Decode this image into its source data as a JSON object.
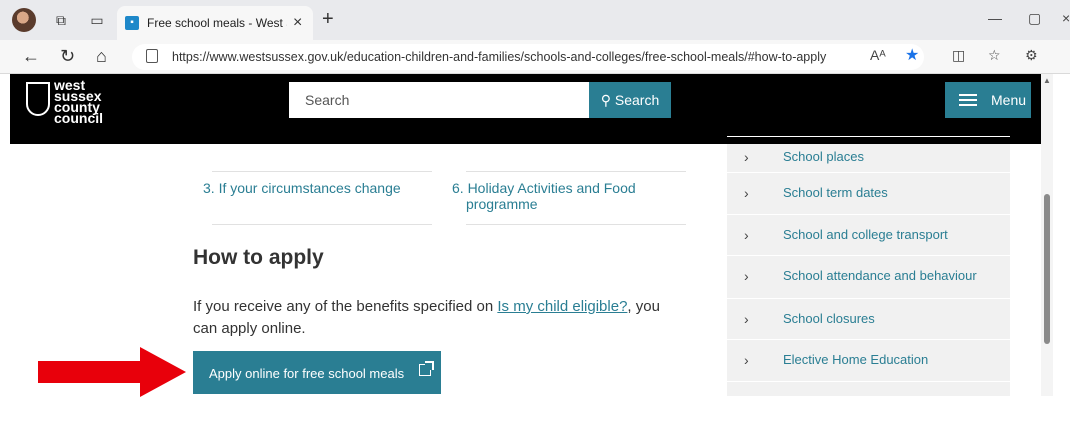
{
  "browser": {
    "tab_title": "Free school meals - West Sussex",
    "url": "https://www.westsussex.gov.uk/education-children-and-families/schools-and-colleges/free-school-meals/#how-to-apply",
    "read_aloud_label": "Aᴬ",
    "icons": [
      "avatar",
      "collections-icon",
      "tab-actions-icon",
      "back-icon",
      "refresh-icon",
      "home-icon",
      "lock-icon",
      "read-aloud-icon",
      "favorite-star-icon",
      "split-screen-icon",
      "favorites-icon",
      "extensions-icon",
      "minimize-icon",
      "maximize-icon",
      "close-icon"
    ]
  },
  "site_header": {
    "logo_lines": [
      "west",
      "sussex",
      "county",
      "council"
    ],
    "search_placeholder": "Search",
    "search_button": "Search",
    "menu_button": "Menu"
  },
  "contents": {
    "item3": "3. If your circumstances change",
    "item6_line1": "6. Holiday Activities and Food",
    "item6_line2": "programme"
  },
  "main": {
    "heading": "How to apply",
    "para_before": "If you receive any of the benefits specified on ",
    "para_link": "Is my child eligible?",
    "para_after": ", you can apply online.",
    "apply_button": "Apply online for free school meals"
  },
  "sidebar": {
    "items": [
      {
        "label": "School places"
      },
      {
        "label": "School term dates"
      },
      {
        "label": "School and college transport"
      },
      {
        "label": "School attendance and behaviour"
      },
      {
        "label": "School closures"
      },
      {
        "label": "Elective Home Education"
      }
    ],
    "chevron": "›"
  },
  "annotation": {
    "arrow_color": "#e8000b"
  }
}
